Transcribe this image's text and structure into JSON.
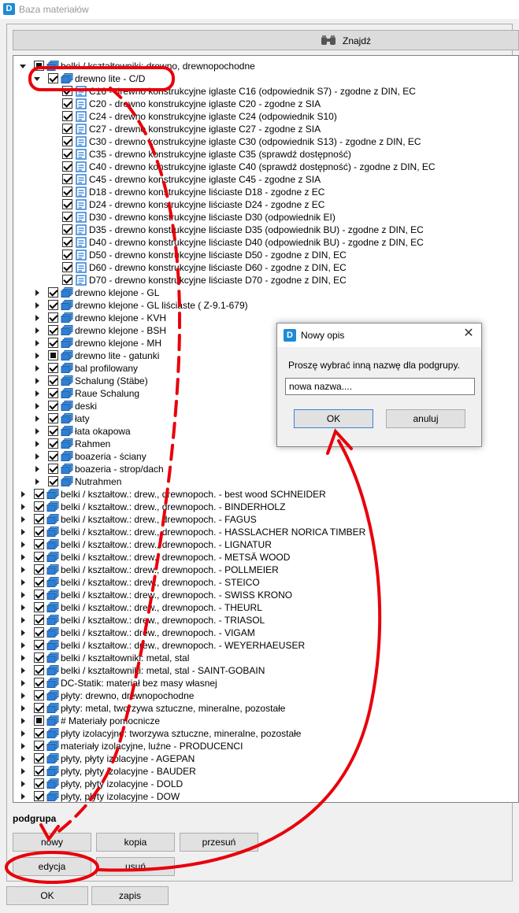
{
  "window": {
    "title": "Baza materiałów",
    "icon": "D"
  },
  "search": {
    "label": "Znajdź",
    "icon": "binoculars-icon"
  },
  "tree": [
    {
      "label": "belki / kształtowniki: drewno, drewnopochodne",
      "level": 0,
      "expand": "open",
      "check": "partial",
      "icon": "folder-stack-icon"
    },
    {
      "label": "drewno lite - C/D",
      "level": 1,
      "expand": "open",
      "check": "checked",
      "icon": "folder-stack-icon"
    },
    {
      "label": "C16 - drewno konstrukcyjne iglaste C16 (odpowiednik S7) - zgodne z DIN, EC",
      "level": 2,
      "expand": "none",
      "check": "checked",
      "icon": "document-icon"
    },
    {
      "label": "C20 - drewno konstrukcyjne iglaste C20 - zgodne z SIA",
      "level": 2,
      "expand": "none",
      "check": "checked",
      "icon": "document-icon"
    },
    {
      "label": "C24 - drewno konstrukcyjne iglaste C24 (odpowiednik S10)",
      "level": 2,
      "expand": "none",
      "check": "checked",
      "icon": "document-icon"
    },
    {
      "label": "C27 - drewno konstrukcyjne iglaste C27 - zgodne z SIA",
      "level": 2,
      "expand": "none",
      "check": "checked",
      "icon": "document-icon"
    },
    {
      "label": "C30 - drewno konstrukcyjne iglaste C30 (odpowiednik S13) - zgodne z DIN, EC",
      "level": 2,
      "expand": "none",
      "check": "checked",
      "icon": "document-icon"
    },
    {
      "label": "C35 - drewno konstrukcyjne iglaste C35 (sprawdź dostępność)",
      "level": 2,
      "expand": "none",
      "check": "checked",
      "icon": "document-icon"
    },
    {
      "label": "C40 - drewno konstrukcyjne iglaste C40 (sprawdź dostępność) - zgodne z DIN, EC",
      "level": 2,
      "expand": "none",
      "check": "checked",
      "icon": "document-icon"
    },
    {
      "label": "C45 - drewno konstrukcyjne iglaste C45 - zgodne z SIA",
      "level": 2,
      "expand": "none",
      "check": "checked",
      "icon": "document-icon"
    },
    {
      "label": "D18 - drewno konstrukcyjne liściaste D18 - zgodne z EC",
      "level": 2,
      "expand": "none",
      "check": "checked",
      "icon": "document-icon"
    },
    {
      "label": "D24 - drewno konstrukcyjne liściaste D24 - zgodne z EC",
      "level": 2,
      "expand": "none",
      "check": "checked",
      "icon": "document-icon"
    },
    {
      "label": "D30 - drewno konstrukcyjne liściaste D30 (odpowiednik EI)",
      "level": 2,
      "expand": "none",
      "check": "checked",
      "icon": "document-icon"
    },
    {
      "label": "D35 - drewno konstrukcyjne liściaste D35 (odpowiednik BU) - zgodne z DIN, EC",
      "level": 2,
      "expand": "none",
      "check": "checked",
      "icon": "document-icon"
    },
    {
      "label": "D40 - drewno konstrukcyjne liściaste D40 (odpowiednik BU) - zgodne z DIN, EC",
      "level": 2,
      "expand": "none",
      "check": "checked",
      "icon": "document-icon"
    },
    {
      "label": "D50 - drewno konstrukcyjne liściaste D50 - zgodne z DIN, EC",
      "level": 2,
      "expand": "none",
      "check": "checked",
      "icon": "document-icon"
    },
    {
      "label": "D60 - drewno konstrukcyjne liściaste D60 - zgodne z DIN, EC",
      "level": 2,
      "expand": "none",
      "check": "checked",
      "icon": "document-icon"
    },
    {
      "label": "D70 - drewno konstrukcyjne liściaste D70 - zgodne z DIN, EC",
      "level": 2,
      "expand": "none",
      "check": "checked",
      "icon": "document-icon"
    },
    {
      "label": "drewno klejone - GL",
      "level": 1,
      "expand": "closed",
      "check": "checked",
      "icon": "folder-stack-icon"
    },
    {
      "label": "drewno klejone - GL liściaste ( Z-9.1-679)",
      "level": 1,
      "expand": "closed",
      "check": "checked",
      "icon": "folder-stack-icon"
    },
    {
      "label": "drewno klejone - KVH",
      "level": 1,
      "expand": "closed",
      "check": "checked",
      "icon": "folder-stack-icon"
    },
    {
      "label": "drewno klejone - BSH",
      "level": 1,
      "expand": "closed",
      "check": "checked",
      "icon": "folder-stack-icon"
    },
    {
      "label": "drewno klejone - MH",
      "level": 1,
      "expand": "closed",
      "check": "checked",
      "icon": "folder-stack-icon"
    },
    {
      "label": "drewno lite - gatunki",
      "level": 1,
      "expand": "closed",
      "check": "partial",
      "icon": "folder-stack-icon"
    },
    {
      "label": "bal profilowany",
      "level": 1,
      "expand": "closed",
      "check": "checked",
      "icon": "folder-stack-icon"
    },
    {
      "label": "Schalung (Stäbe)",
      "level": 1,
      "expand": "closed",
      "check": "checked",
      "icon": "folder-stack-icon"
    },
    {
      "label": "Raue Schalung",
      "level": 1,
      "expand": "closed",
      "check": "checked",
      "icon": "folder-stack-icon"
    },
    {
      "label": "deski",
      "level": 1,
      "expand": "closed",
      "check": "checked",
      "icon": "folder-stack-icon"
    },
    {
      "label": "łaty",
      "level": 1,
      "expand": "closed",
      "check": "checked",
      "icon": "folder-stack-icon"
    },
    {
      "label": "łata okapowa",
      "level": 1,
      "expand": "closed",
      "check": "checked",
      "icon": "folder-stack-icon"
    },
    {
      "label": "Rahmen",
      "level": 1,
      "expand": "closed",
      "check": "checked",
      "icon": "folder-stack-icon"
    },
    {
      "label": "boazeria - ściany",
      "level": 1,
      "expand": "closed",
      "check": "checked",
      "icon": "folder-stack-icon"
    },
    {
      "label": "boazeria - strop/dach",
      "level": 1,
      "expand": "closed",
      "check": "checked",
      "icon": "folder-stack-icon"
    },
    {
      "label": "Nutrahmen",
      "level": 1,
      "expand": "closed",
      "check": "checked",
      "icon": "folder-stack-icon"
    },
    {
      "label": "belki / kształtow.: drew., drewnopoch. - best wood SCHNEIDER",
      "level": 0,
      "expand": "closed",
      "check": "checked",
      "icon": "folder-stack-icon"
    },
    {
      "label": "belki / kształtow.: drew., drewnopoch. - BINDERHOLZ",
      "level": 0,
      "expand": "closed",
      "check": "checked",
      "icon": "folder-stack-icon"
    },
    {
      "label": "belki / kształtow.: drew., drewnopoch. - FAGUS",
      "level": 0,
      "expand": "closed",
      "check": "checked",
      "icon": "folder-stack-icon"
    },
    {
      "label": "belki / kształtow.: drew., drewnopoch. - HASSLACHER NORICA TIMBER",
      "level": 0,
      "expand": "closed",
      "check": "checked",
      "icon": "folder-stack-icon"
    },
    {
      "label": "belki / kształtow.: drew., drewnopoch. - LIGNATUR",
      "level": 0,
      "expand": "closed",
      "check": "checked",
      "icon": "folder-stack-icon"
    },
    {
      "label": "belki / kształtow.: drew., drewnopoch. - METSÄ WOOD",
      "level": 0,
      "expand": "closed",
      "check": "checked",
      "icon": "folder-stack-icon"
    },
    {
      "label": "belki / kształtow.: drew., drewnopoch. - POLLMEIER",
      "level": 0,
      "expand": "closed",
      "check": "checked",
      "icon": "folder-stack-icon"
    },
    {
      "label": "belki / kształtow.: drew., drewnopoch. - STEICO",
      "level": 0,
      "expand": "closed",
      "check": "checked",
      "icon": "folder-stack-icon"
    },
    {
      "label": "belki / kształtow.: drew., drewnopoch. - SWISS KRONO",
      "level": 0,
      "expand": "closed",
      "check": "checked",
      "icon": "folder-stack-icon"
    },
    {
      "label": "belki / kształtow.: drew., drewnopoch. - THEURL",
      "level": 0,
      "expand": "closed",
      "check": "checked",
      "icon": "folder-stack-icon"
    },
    {
      "label": "belki / kształtow.: drew., drewnopoch. - TRIASOL",
      "level": 0,
      "expand": "closed",
      "check": "checked",
      "icon": "folder-stack-icon"
    },
    {
      "label": "belki / kształtow.: drew., drewnopoch. - VIGAM",
      "level": 0,
      "expand": "closed",
      "check": "checked",
      "icon": "folder-stack-icon"
    },
    {
      "label": "belki / kształtow.: drew., drewnopoch. - WEYERHAEUSER",
      "level": 0,
      "expand": "closed",
      "check": "checked",
      "icon": "folder-stack-icon"
    },
    {
      "label": "belki / kształtowniki: metal, stal",
      "level": 0,
      "expand": "closed",
      "check": "checked",
      "icon": "folder-stack-icon"
    },
    {
      "label": "belki / kształtowniki: metal, stal - SAINT-GOBAIN",
      "level": 0,
      "expand": "closed",
      "check": "checked",
      "icon": "folder-stack-icon"
    },
    {
      "label": "DC-Statik: materiał bez masy własnej",
      "level": 0,
      "expand": "closed",
      "check": "checked",
      "icon": "folder-stack-icon"
    },
    {
      "label": "płyty: drewno, drewnopochodne",
      "level": 0,
      "expand": "closed",
      "check": "checked",
      "icon": "folder-stack-icon"
    },
    {
      "label": "płyty: metal, tworzywa sztuczne, mineralne, pozostałe",
      "level": 0,
      "expand": "closed",
      "check": "checked",
      "icon": "folder-stack-icon"
    },
    {
      "label": "# Materiały pomocnicze",
      "level": 0,
      "expand": "closed",
      "check": "partial",
      "icon": "folder-stack-icon"
    },
    {
      "label": "płyty izolacyjne: tworzywa sztuczne, mineralne, pozostałe",
      "level": 0,
      "expand": "closed",
      "check": "checked",
      "icon": "folder-stack-icon"
    },
    {
      "label": "materiały izolacyjne, luźne - PRODUCENCI",
      "level": 0,
      "expand": "closed",
      "check": "checked",
      "icon": "folder-stack-icon"
    },
    {
      "label": "płyty, płyty izolacyjne - AGEPAN",
      "level": 0,
      "expand": "closed",
      "check": "checked",
      "icon": "folder-stack-icon"
    },
    {
      "label": "płyty, płyty izolacyjne - BAUDER",
      "level": 0,
      "expand": "closed",
      "check": "checked",
      "icon": "folder-stack-icon"
    },
    {
      "label": "płyty, płyty izolacyjne - DOLD",
      "level": 0,
      "expand": "closed",
      "check": "checked",
      "icon": "folder-stack-icon"
    },
    {
      "label": "płyty, płyty izolacyjne - DOW",
      "level": 0,
      "expand": "closed",
      "check": "checked",
      "icon": "folder-stack-icon"
    }
  ],
  "subgroup": {
    "section_label": "podgrupa",
    "buttons": {
      "new": "nowy",
      "copy": "kopia",
      "move": "przesuń",
      "edit": "edycja",
      "delete": "usuń"
    }
  },
  "footer": {
    "ok": "OK",
    "save": "zapis"
  },
  "dialog": {
    "title": "Nowy opis",
    "icon": "D",
    "message": "Proszę wybrać inną nazwę dla podgrupy.",
    "input_value": "nowa nazwa....",
    "ok": "OK",
    "cancel": "anuluj"
  },
  "annotation": {
    "color": "#e8000b"
  },
  "colors": {
    "folder_icon": "#2f7fd6",
    "document_icon": "#2f7fd6"
  }
}
